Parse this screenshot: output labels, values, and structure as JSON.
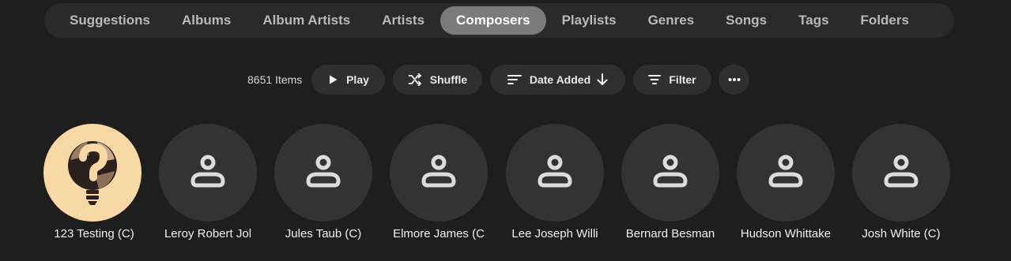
{
  "tabs": [
    {
      "label": "Suggestions",
      "active": false
    },
    {
      "label": "Albums",
      "active": false
    },
    {
      "label": "Album Artists",
      "active": false
    },
    {
      "label": "Artists",
      "active": false
    },
    {
      "label": "Composers",
      "active": true
    },
    {
      "label": "Playlists",
      "active": false
    },
    {
      "label": "Genres",
      "active": false
    },
    {
      "label": "Songs",
      "active": false
    },
    {
      "label": "Tags",
      "active": false
    },
    {
      "label": "Folders",
      "active": false
    }
  ],
  "toolbar": {
    "item_count": "8651 Items",
    "play_label": "Play",
    "shuffle_label": "Shuffle",
    "sort_label": "Date Added",
    "filter_label": "Filter"
  },
  "composers": [
    {
      "name": "123 Testing (C)",
      "image": "lightbulb-question-art"
    },
    {
      "name": "Leroy Robert Jol",
      "image": "person-icon"
    },
    {
      "name": "Jules Taub (C)",
      "image": "person-icon"
    },
    {
      "name": "Elmore James (C",
      "image": "person-icon"
    },
    {
      "name": "Lee Joseph Willi",
      "image": "person-icon"
    },
    {
      "name": "Bernard Besman",
      "image": "person-icon"
    },
    {
      "name": "Hudson Whittake",
      "image": "person-icon"
    },
    {
      "name": "Josh White (C)",
      "image": "person-icon"
    }
  ],
  "colors": {
    "background": "#1e1e1e",
    "tab_bar": "#2a2a2a",
    "tab_active": "#7b7b7b",
    "button": "#2f2f2f",
    "avatar": "#333333",
    "art_background": "#f8d9a6"
  }
}
